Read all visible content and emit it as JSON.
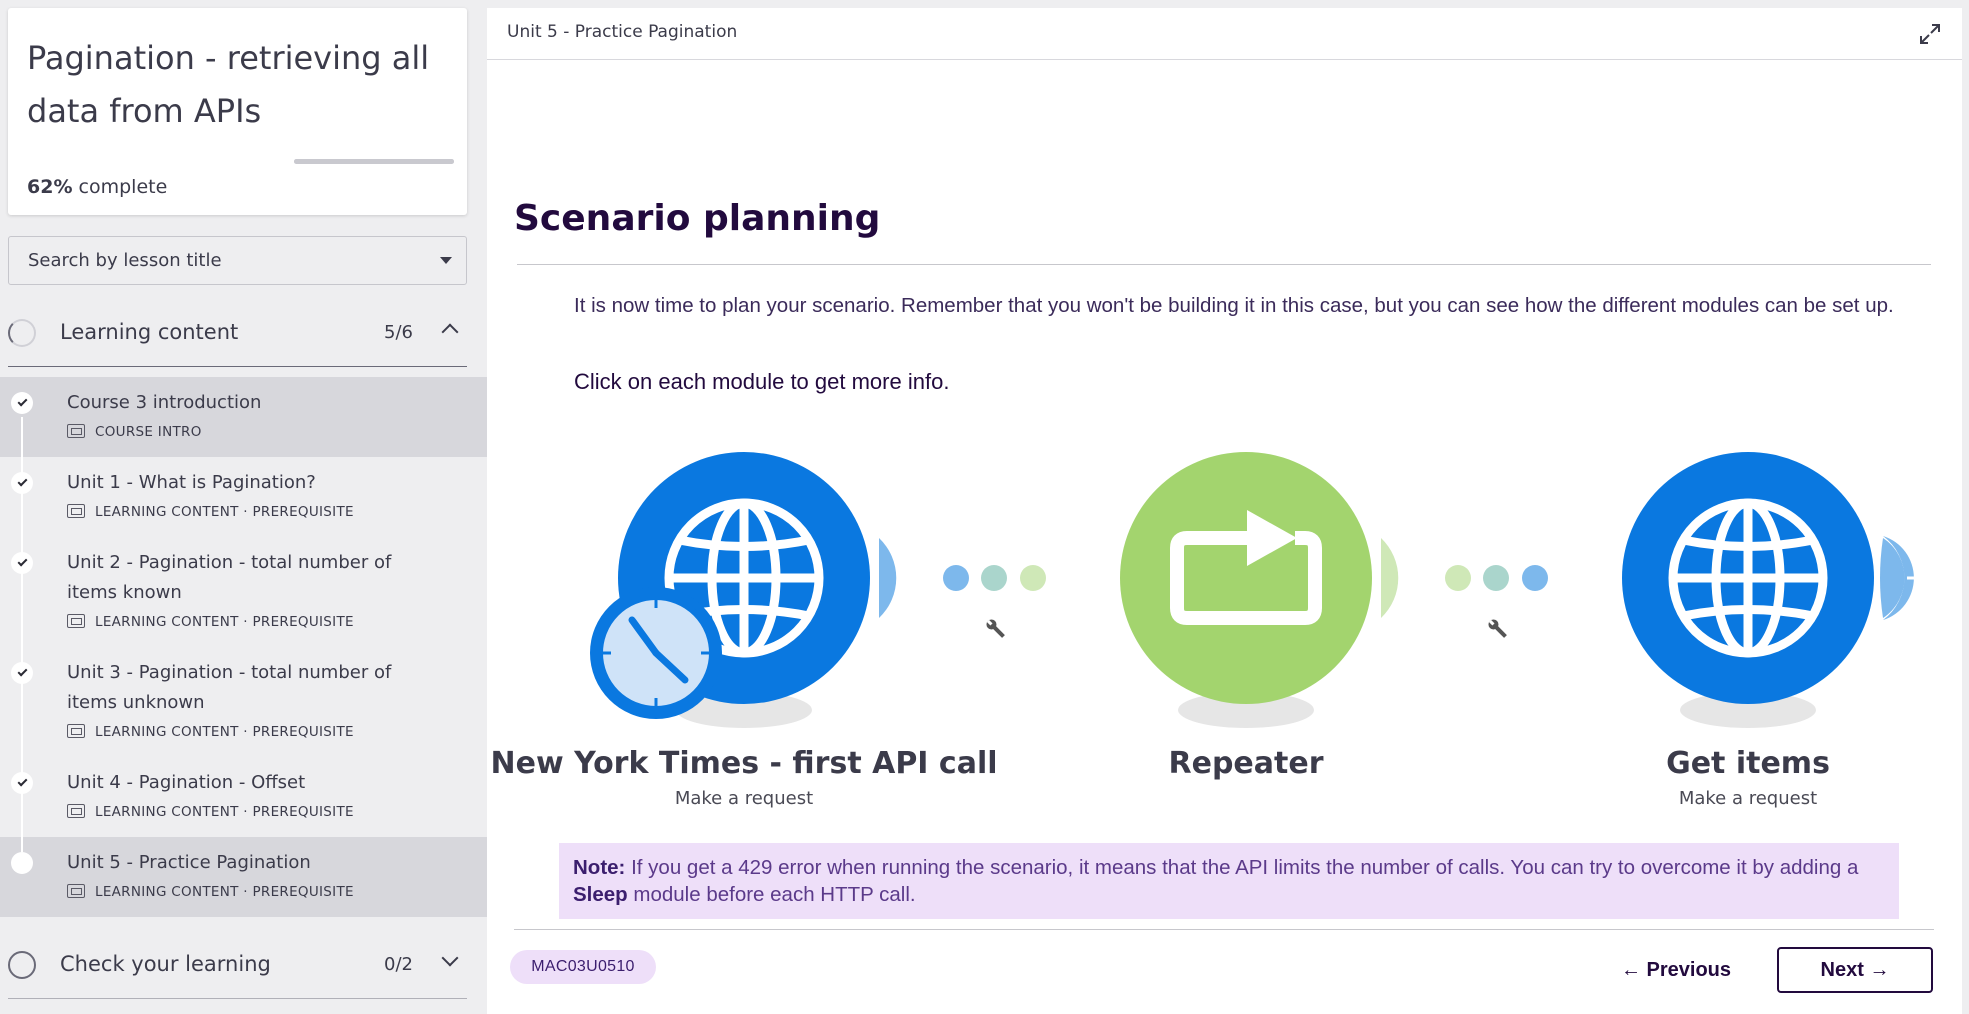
{
  "sidebar": {
    "course_title": "Pagination - retrieving all data from APIs",
    "progress_percent": "62%",
    "progress_suffix": " complete",
    "progress_value": 0.62,
    "search_placeholder": "Search by lesson title",
    "sections": [
      {
        "title": "Learning content",
        "count": "5/6"
      },
      {
        "title": "Check your learning",
        "count": "0/2"
      }
    ],
    "lessons": [
      {
        "title": "Course 3 introduction",
        "meta": "COURSE INTRO",
        "done": true
      },
      {
        "title": "Unit 1 - What is Pagination?",
        "meta": "LEARNING CONTENT · PREREQUISITE",
        "done": true
      },
      {
        "title": "Unit 2 - Pagination - total number of items known",
        "meta": "LEARNING CONTENT · PREREQUISITE",
        "done": true
      },
      {
        "title": "Unit 3 - Pagination - total number of items unknown",
        "meta": "LEARNING CONTENT · PREREQUISITE",
        "done": true
      },
      {
        "title": "Unit 4 - Pagination - Offset",
        "meta": "LEARNING CONTENT · PREREQUISITE",
        "done": true
      },
      {
        "title": "Unit 5 - Practice Pagination",
        "meta": "LEARNING CONTENT · PREREQUISITE",
        "done": false
      }
    ]
  },
  "main": {
    "breadcrumb": "Unit 5 - Practice Pagination",
    "heading": "Scenario planning",
    "paragraph": "It is now time to plan your scenario. Remember that you won't be building it in this case, but you can see how the different modules can be set up.",
    "instruction": "Click on each module to get more info",
    "instruction_end": ".",
    "modules": [
      {
        "name": "New York Times - first API call",
        "sub": "Make a request"
      },
      {
        "name": "Repeater",
        "sub": ""
      },
      {
        "name": "Get items",
        "sub": "Make a request"
      }
    ],
    "note": {
      "label": "Note:",
      "text1": " If you get a 429 error when running the scenario, it means that the API limits the number of calls. You can try to overcome it by adding a ",
      "bold": "Sleep",
      "text2": " module before each HTTP call."
    },
    "code": "MAC03U0510",
    "prev_label": "← Previous",
    "next_label": "Next →"
  },
  "colors": {
    "http_blue": "#0a78e0",
    "repeater_green": "#a3d46e",
    "accent_purple": "#220a3e",
    "note_bg": "#eedff9"
  },
  "icons": [
    "globe-icon",
    "clock-icon",
    "repeat-icon",
    "wrench-icon",
    "plus-icon",
    "expand-icon",
    "check-icon",
    "chevron-up-icon",
    "chevron-down-icon",
    "caret-down-icon",
    "lesson-type-icon"
  ]
}
